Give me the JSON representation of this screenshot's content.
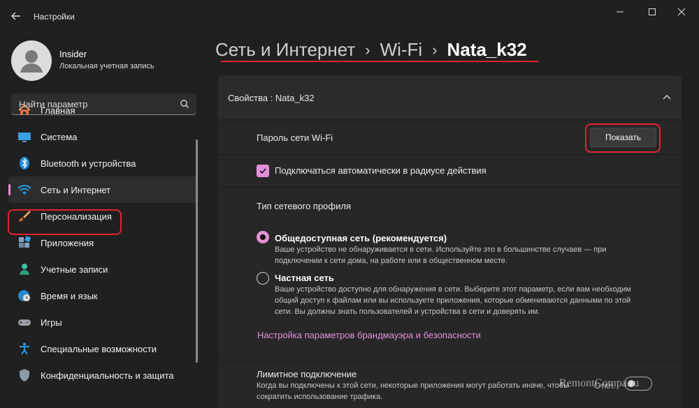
{
  "window": {
    "title": "Настройки"
  },
  "user": {
    "name": "Insider",
    "account_type": "Локальная учетная запись"
  },
  "search": {
    "placeholder": "Найти параметр"
  },
  "sidebar": {
    "items": [
      {
        "label": "Главная",
        "icon": "home-icon"
      },
      {
        "label": "Система",
        "icon": "monitor-icon"
      },
      {
        "label": "Bluetooth и устройства",
        "icon": "bluetooth-icon"
      },
      {
        "label": "Сеть и Интернет",
        "icon": "wifi-icon",
        "active": true
      },
      {
        "label": "Персонализация",
        "icon": "brush-icon"
      },
      {
        "label": "Приложения",
        "icon": "apps-icon"
      },
      {
        "label": "Учетные записи",
        "icon": "account-icon"
      },
      {
        "label": "Время и язык",
        "icon": "globe-clock-icon"
      },
      {
        "label": "Игры",
        "icon": "gamepad-icon"
      },
      {
        "label": "Специальные возможности",
        "icon": "accessibility-icon"
      },
      {
        "label": "Конфиденциальность и защита",
        "icon": "shield-icon"
      }
    ]
  },
  "breadcrumb": {
    "level1": "Сеть и Интернет",
    "level2": "Wi-Fi",
    "current": "Nata_k32"
  },
  "properties": {
    "header": "Свойства : Nata_k32",
    "wifi_password_label": "Пароль сети Wi-Fi",
    "show_button": "Показать",
    "auto_connect_label": "Подключаться автоматически в радиусе действия",
    "auto_connect_checked": true,
    "profile_type_label": "Тип сетевого профиля",
    "public": {
      "title": "Общедоступная сеть (рекомендуется)",
      "desc1": "Ваше устройство не обнаруживается в сети. Используйте это в большинстве случаев — при",
      "desc2": "подключении к сети дома, на работе или в общественном месте.",
      "selected": true
    },
    "private": {
      "title": "Частная сеть",
      "desc1": "Ваше устройство доступно для обнаружения в сети. Выберите этот параметр, если вам необходим",
      "desc2": "общий доступ к файлам или вы используете приложения, которые обмениваются данными по этой",
      "desc3": "сети. Вы должны знать пользователей и устройства в сети и доверять им.",
      "selected": false
    },
    "firewall_link": "Настройка параметров брандмауэра и безопасности",
    "metered_label": "Лимитное подключение",
    "metered_desc1": "Когда вы подключены к этой сети, некоторые приложения могут работать иначе, чтобы",
    "metered_desc2": "сократить использование трафика.",
    "metered_toggle_state": "Откл."
  },
  "watermark": "RemontCompa.ru",
  "colors": {
    "accent": "#e58fd8",
    "background": "#202020",
    "card": "#272727",
    "highlight": "#e0242f"
  }
}
